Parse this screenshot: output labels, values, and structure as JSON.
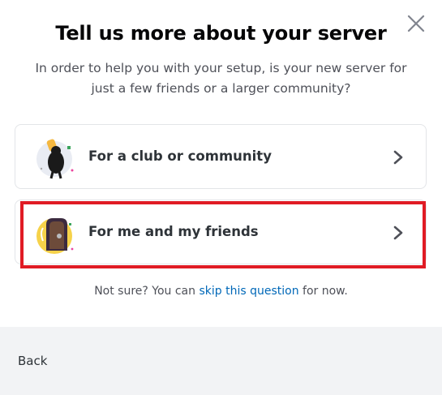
{
  "modal": {
    "title": "Tell us more about your server",
    "subtitle_line1": "In order to help you with your setup, is your new server for",
    "subtitle_line2": "just a few friends or a larger community?",
    "close_icon": "close-icon"
  },
  "options": [
    {
      "label": "For a club or community",
      "icon": "club-community-illustration",
      "chevron": "chevron-right-icon"
    },
    {
      "label": "For me and my friends",
      "icon": "friends-illustration",
      "chevron": "chevron-right-icon"
    }
  ],
  "skip": {
    "prefix": "Not sure? You can ",
    "link": "skip this question",
    "suffix": " for now."
  },
  "footer": {
    "back_label": "Back"
  },
  "colors": {
    "highlight": "#e01b24",
    "link": "#0068b8",
    "footer_bg": "#f2f3f5"
  }
}
